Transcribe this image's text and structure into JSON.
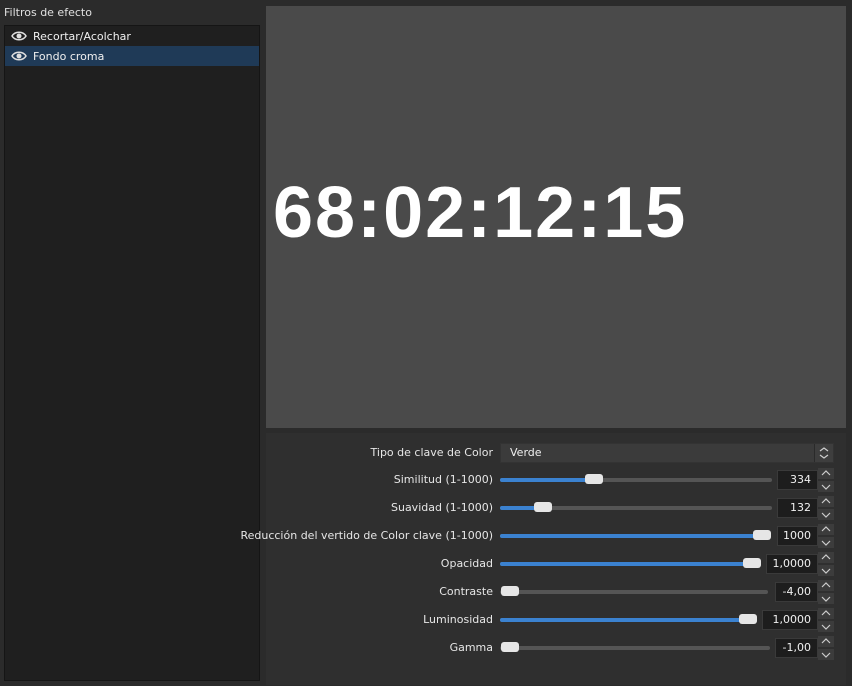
{
  "filters_panel": {
    "title": "Filtros de efecto",
    "items": [
      {
        "label": "Recortar/Acolchar",
        "visible_icon": "eye-icon",
        "selected": false
      },
      {
        "label": "Fondo croma",
        "visible_icon": "eye-icon",
        "selected": true
      }
    ]
  },
  "preview": {
    "text": "68:02:12:15"
  },
  "properties": {
    "key_color_type": {
      "label": "Tipo de clave de Color",
      "value": "Verde"
    },
    "similarity": {
      "label": "Similitud (1-1000)",
      "value": "334",
      "fraction": 0.334
    },
    "smoothness": {
      "label": "Suavidad (1-1000)",
      "value": "132",
      "fraction": 0.132
    },
    "spill_reduction": {
      "label": "Reducción del vertido de Color clave (1-1000)",
      "value": "1000",
      "fraction": 1.0
    },
    "opacity": {
      "label": "Opacidad",
      "value": "1,0000",
      "fraction": 1.0
    },
    "contrast": {
      "label": "Contraste",
      "value": "-4,00",
      "fraction": 0.0
    },
    "brightness": {
      "label": "Luminosidad",
      "value": "1,0000",
      "fraction": 1.0
    },
    "gamma": {
      "label": "Gamma",
      "value": "-1,00",
      "fraction": 0.0
    }
  },
  "colors": {
    "accent": "#3b82d0",
    "selection": "#1f3a57",
    "preview_bg": "#4a4a4a"
  }
}
